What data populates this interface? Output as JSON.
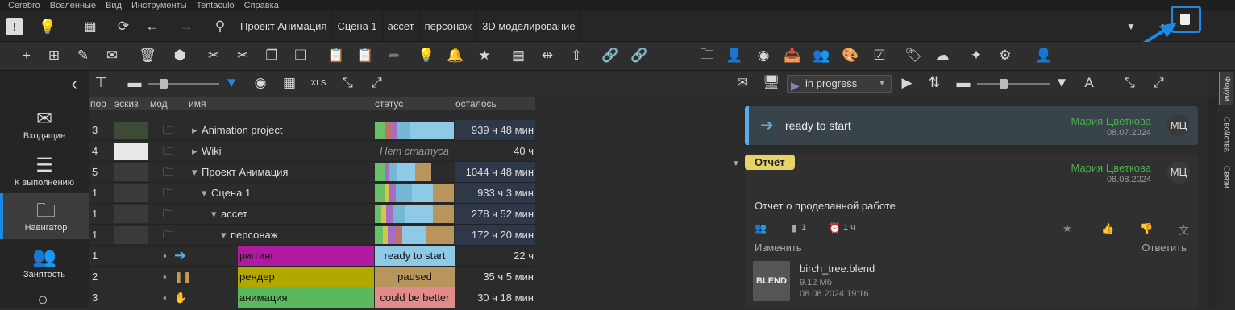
{
  "menu": [
    "Cerebro",
    "Вселенные",
    "Вид",
    "Инструменты",
    "Tentaculo",
    "Справка"
  ],
  "breadcrumbs": [
    "Проект Анимация",
    "Сцена 1",
    "ассет",
    "персонаж",
    "3D моделирование"
  ],
  "leftnav": [
    {
      "label": "Входящие",
      "icon": "inbox-icon",
      "glyph": "✉"
    },
    {
      "label": "К выполнению",
      "icon": "list-icon",
      "glyph": "☰"
    },
    {
      "label": "Навигатор",
      "icon": "folder-icon",
      "glyph": "🗀"
    },
    {
      "label": "Занятость",
      "icon": "people-icon",
      "glyph": "👥"
    }
  ],
  "tree_headers": {
    "order": "пор",
    "thumb": "эскиз",
    "mod": "мод",
    "name": "имя",
    "status": "статус",
    "remaining": "осталось"
  },
  "rows": [
    {
      "order": "3",
      "name": "Animation project",
      "status": "",
      "remaining": "939 ч 48 мин",
      "indent": 0,
      "arrow": "▸"
    },
    {
      "order": "4",
      "name": "Wiki",
      "status": "Нет статуса",
      "remaining": "40 ч",
      "indent": 0,
      "arrow": "▸"
    },
    {
      "order": "5",
      "name": "Проект Анимация",
      "status": "",
      "remaining": "1044 ч 48 мин",
      "indent": 0,
      "arrow": "▾"
    },
    {
      "order": "1",
      "name": "Сцена 1",
      "status": "",
      "remaining": "933 ч 3 мин",
      "indent": 1,
      "arrow": "▾"
    },
    {
      "order": "1",
      "name": "ассет",
      "status": "",
      "remaining": "278 ч 52 мин",
      "indent": 2,
      "arrow": "▾"
    },
    {
      "order": "1",
      "name": "персонаж",
      "status": "",
      "remaining": "172 ч 20 мин",
      "indent": 3,
      "arrow": "▾"
    },
    {
      "order": "1",
      "name": "риггинг",
      "status": "ready to start",
      "remaining": "22 ч",
      "indent": 0,
      "arrow": ""
    },
    {
      "order": "2",
      "name": "рендер",
      "status": "paused",
      "remaining": "35 ч 5 мин",
      "indent": 0,
      "arrow": ""
    },
    {
      "order": "3",
      "name": "анимация",
      "status": "could be better",
      "remaining": "30 ч 18 мин",
      "indent": 0,
      "arrow": ""
    }
  ],
  "status_dropdown": "in progress",
  "forum": {
    "msg1": {
      "text": "ready to start",
      "author": "Мария Цветкова",
      "date": "08.07.2024",
      "avatar": "МЦ"
    },
    "msg2": {
      "badge": "Отчёт",
      "author": "Мария Цветкова",
      "date": "08.08.2024",
      "avatar": "МЦ",
      "body": "Отчет о проделанной работе",
      "files": "1",
      "time": "1 ч",
      "edit": "Изменить",
      "reply": "Ответить"
    },
    "attachment": {
      "type": "BLEND",
      "name": "birch_tree.blend",
      "size": "9.12 Мб",
      "date": "08.08.2024 19:16"
    }
  },
  "side_tabs": [
    "Форум",
    "Свойства",
    "Связи"
  ],
  "colors": {
    "accent": "#1e88e5",
    "green": "#4caf50",
    "badge": "#e6d36a"
  }
}
